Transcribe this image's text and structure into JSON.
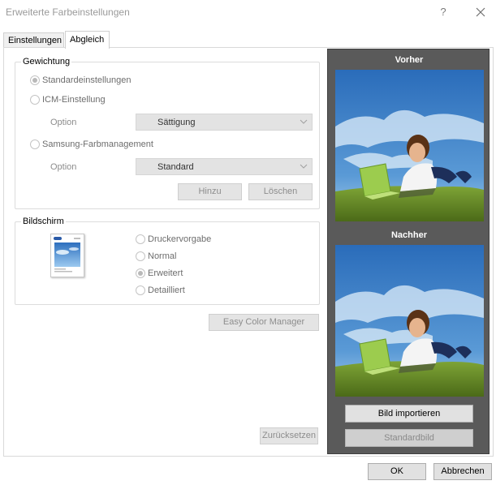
{
  "window": {
    "title": "Erweiterte Farbeinstellungen",
    "help_glyph": "?"
  },
  "tabs": [
    {
      "label": "Einstellungen",
      "active": false
    },
    {
      "label": "Abgleich",
      "active": true
    }
  ],
  "gewichtung": {
    "label": "Gewichtung",
    "options": [
      {
        "label": "Standardeinstellungen",
        "selected": true
      },
      {
        "label": "ICM-Einstellung",
        "selected": false
      },
      {
        "label": "Samsung-Farbmanagement",
        "selected": false
      }
    ],
    "icm_option_label": "Option",
    "icm_option_value": "Sättigung",
    "samsung_option_label": "Option",
    "samsung_option_value": "Standard",
    "add_label": "Hinzu",
    "delete_label": "Löschen"
  },
  "bildschirm": {
    "label": "Bildschirm",
    "options": [
      {
        "label": "Druckervorgabe",
        "selected": false
      },
      {
        "label": "Normal",
        "selected": false
      },
      {
        "label": "Erweitert",
        "selected": true
      },
      {
        "label": "Detailliert",
        "selected": false
      }
    ]
  },
  "easy_color_manager_label": "Easy Color Manager",
  "reset_label": "Zurücksetzen",
  "preview": {
    "before_label": "Vorher",
    "after_label": "Nachher",
    "import_label": "Bild importieren",
    "default_image_label": "Standardbild"
  },
  "footer": {
    "ok_label": "OK",
    "cancel_label": "Abbrechen"
  },
  "colors": {
    "preview_bg": "#5a5a5a",
    "sky": "#3f86c8",
    "grass": "#6d8f2a",
    "disabled_text": "#8d8d8d"
  }
}
